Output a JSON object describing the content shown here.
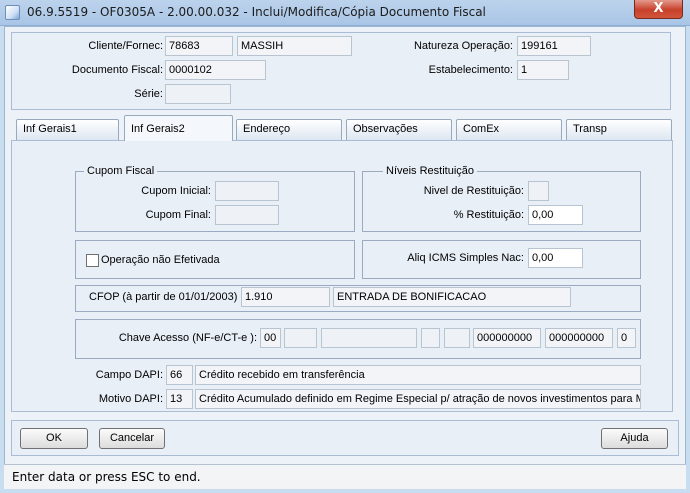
{
  "window": {
    "title": "06.9.5519 - OF0305A - 2.00.00.032 - Inclui/Modifica/Cópia Documento Fiscal",
    "close_label": "X"
  },
  "header": {
    "cliente_label": "Cliente/Fornec:",
    "cliente_code": "78683",
    "cliente_name": "MASSIH",
    "natureza_label": "Natureza Operação:",
    "natureza_value": "199161",
    "documento_label": "Documento Fiscal:",
    "documento_value": "0000102",
    "estabelecimento_label": "Estabelecimento:",
    "estabelecimento_value": "1",
    "serie_label": "Série:",
    "serie_value": ""
  },
  "tabs": [
    {
      "label": "Inf Gerais1"
    },
    {
      "label": "Inf Gerais2"
    },
    {
      "label": "Endereço"
    },
    {
      "label": "Observações"
    },
    {
      "label": "ComEx"
    },
    {
      "label": "Transp"
    }
  ],
  "cupom": {
    "title": "Cupom Fiscal",
    "inicial_label": "Cupom Inicial:",
    "inicial_value": "",
    "final_label": "Cupom Final:",
    "final_value": ""
  },
  "restituicao": {
    "title": "Níveis Restituição",
    "nivel_label": "Nivel de Restituição:",
    "nivel_value": "",
    "pct_label": "% Restituição:",
    "pct_value": "0,00"
  },
  "operacao": {
    "label": "Operação não Efetivada",
    "checked": false
  },
  "aliq": {
    "label": "Aliq ICMS Simples Nac:",
    "value": "0,00"
  },
  "cfop": {
    "label": "CFOP (à partir de 01/01/2003)",
    "code": "1.910",
    "description": "ENTRADA DE BONIFICACAO"
  },
  "chave": {
    "label": "Chave Acesso (NF-e/CT-e ):",
    "part1": "00",
    "part2": "",
    "part3": "",
    "part4": "",
    "part5": "",
    "part6": "000000000",
    "part7": "000000000",
    "part8": "0"
  },
  "dapi": {
    "campo_label": "Campo DAPI:",
    "campo_code": "66",
    "campo_desc": "Crédito recebido em transferência",
    "motivo_label": "Motivo DAPI:",
    "motivo_code": "13",
    "motivo_desc": "Crédito Acumulado definido em Regime Especial p/ atração de novos investimentos para MG"
  },
  "buttons": {
    "ok": "OK",
    "cancel": "Cancelar",
    "help": "Ajuda"
  },
  "status": {
    "text": "Enter data or press ESC to end."
  }
}
